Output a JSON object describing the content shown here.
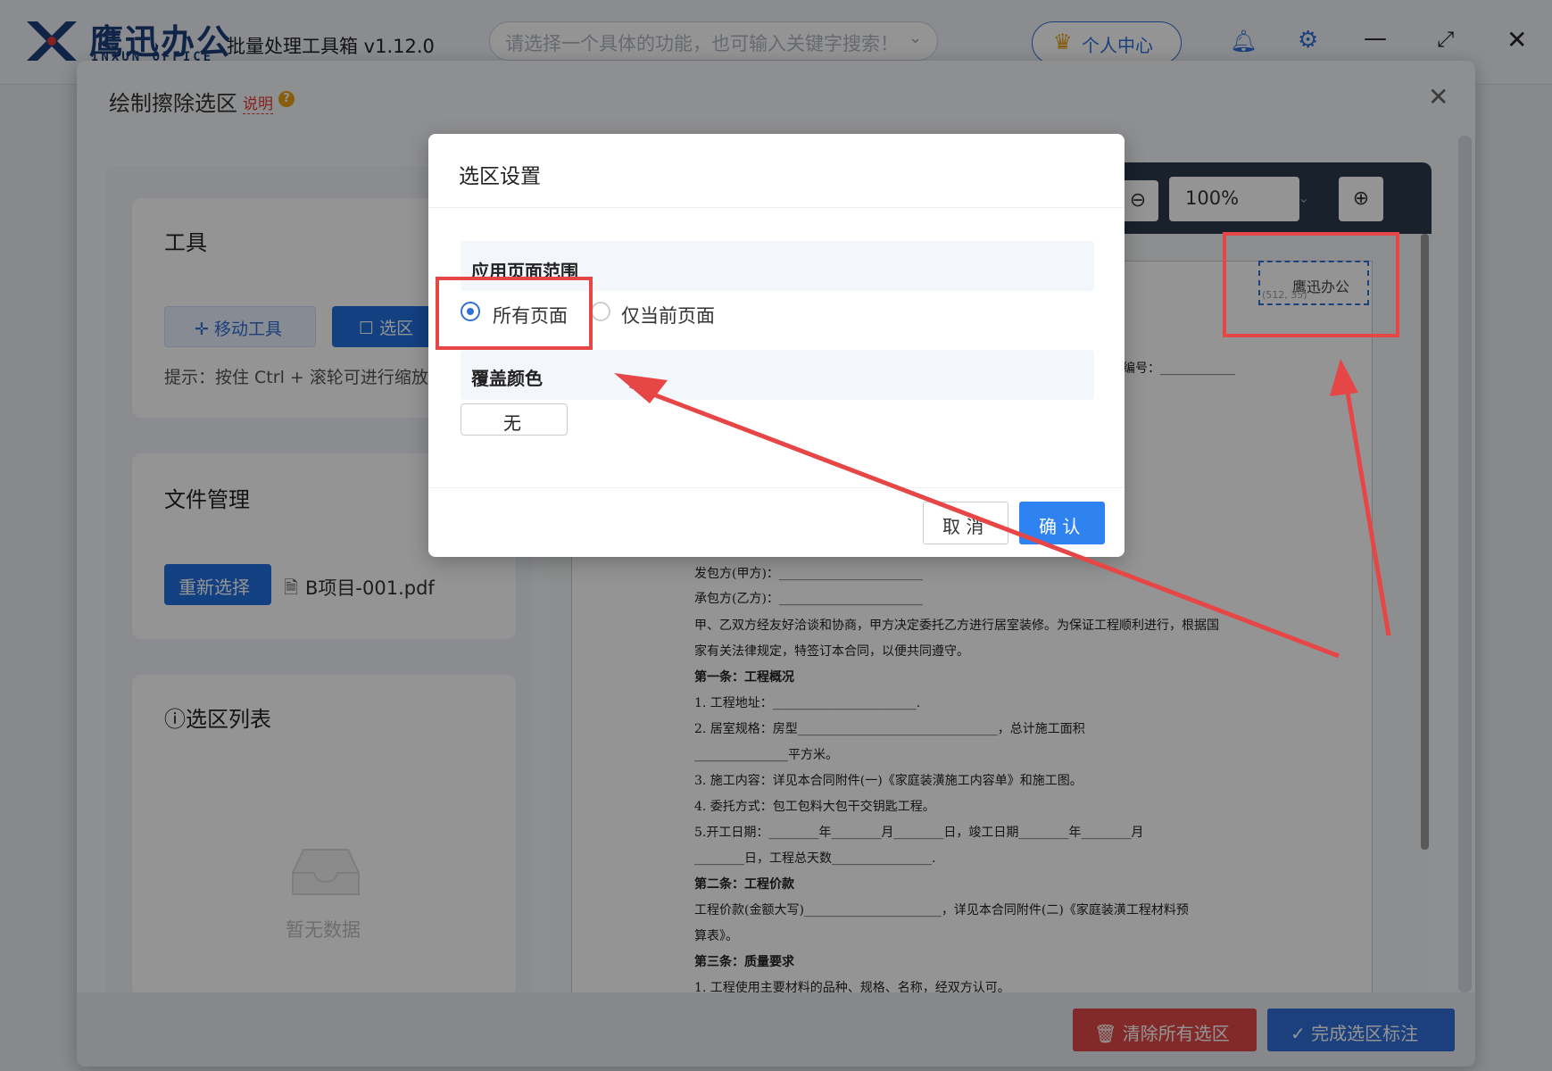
{
  "app": {
    "logo_cn": "鹰迅办公",
    "logo_en": "INXUN OFFICE",
    "title": "批量处理工具箱 v1.12.0",
    "search_placeholder": "请选择一个具体的功能，也可输入关键字搜索！",
    "user_center": "个人中心"
  },
  "outer_dialog": {
    "title": "绘制擦除选区",
    "explain_link": "说明",
    "tools": {
      "title": "工具",
      "move_tool": "移动工具",
      "select_tool": "选区",
      "tip": "提示：按住 Ctrl + 滚轮可进行缩放"
    },
    "files": {
      "title": "文件管理",
      "reselect": "重新选择",
      "filename": "B项目-001.pdf"
    },
    "selection_list": {
      "title": "选区列表",
      "empty": "暂无数据"
    },
    "viewer": {
      "zoom": "100%",
      "watermark_text": "鹰迅办公",
      "watermark_coord": "(512, 35)",
      "doc_lines": [
        "编号：____________",
        "发包方(甲方)：_______________________",
        "承包方(乙方)：_______________________",
        "甲、乙双方经友好洽谈和协商，甲方决定委托乙方进行居室装修。为保证工程顺利进行，根据国",
        "家有关法律规定，特签订本合同，以便共同遵守。",
        "第一条：工程概况",
        "1. 工程地址：_______________________.",
        "2. 居室规格：房型________________________________，总计施工面积",
        "_______________平方米。",
        "3. 施工内容：详见本合同附件(一)《家庭装潢施工内容单》和施工图。",
        "4. 委托方式：包工包料大包干交钥匙工程。",
        "5.开工日期：________年________月________日，竣工日期________年________月",
        "________日，工程总天数________________.",
        "第二条：工程价款",
        "工程价款(金额大写)______________________，详见本合同附件(二)《家庭装潢工程材料预",
        "算表》。",
        "第三条：质量要求",
        "1. 工程使用主要材料的品种、规格、名称，经双方认可。"
      ]
    },
    "clear_all": "清除所有选区",
    "finish": "完成选区标注"
  },
  "modal": {
    "title": "选区设置",
    "page_range_title": "应用页面范围",
    "option_all": "所有页面",
    "option_current": "仅当前页面",
    "cover_color_title": "覆盖颜色",
    "cover_color_value": "无",
    "cancel": "取 消",
    "confirm": "确 认",
    "selected_range": "所有页面"
  },
  "colors": {
    "primary": "#2f6fd8",
    "danger": "#e04848",
    "annotation": "#e64646"
  }
}
